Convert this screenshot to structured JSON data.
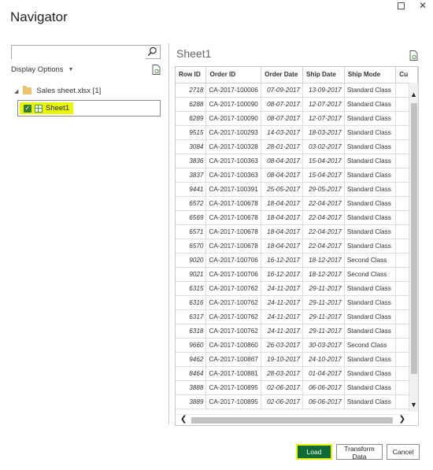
{
  "window": {
    "title": "Navigator",
    "maximize_icon": "maximize-icon",
    "close_glyph": "✕"
  },
  "left": {
    "search": {
      "value": "",
      "placeholder": ""
    },
    "display_options_label": "Display Options",
    "file_label": "Sales sheet.xlsx [1]",
    "sheet_label": "Sheet1",
    "sheet_checked": true,
    "highlight_color": "#e9f600"
  },
  "preview": {
    "title": "Sheet1",
    "columns": [
      "Row ID",
      "Order ID",
      "Order Date",
      "Ship Date",
      "Ship Mode",
      "Cu"
    ],
    "rows": [
      [
        "2718",
        "CA-2017-100006",
        "07-09-2017",
        "13-09-2017",
        "Standard Class"
      ],
      [
        "6288",
        "CA-2017-100090",
        "08-07-2017",
        "12-07-2017",
        "Standard Class"
      ],
      [
        "6289",
        "CA-2017-100090",
        "08-07-2017",
        "12-07-2017",
        "Standard Class"
      ],
      [
        "9515",
        "CA-2017-100293",
        "14-03-2017",
        "18-03-2017",
        "Standard Class"
      ],
      [
        "3084",
        "CA-2017-100328",
        "28-01-2017",
        "03-02-2017",
        "Standard Class"
      ],
      [
        "3836",
        "CA-2017-100363",
        "08-04-2017",
        "15-04-2017",
        "Standard Class"
      ],
      [
        "3837",
        "CA-2017-100363",
        "08-04-2017",
        "15-04-2017",
        "Standard Class"
      ],
      [
        "9441",
        "CA-2017-100391",
        "25-05-2017",
        "29-05-2017",
        "Standard Class"
      ],
      [
        "6572",
        "CA-2017-100678",
        "18-04-2017",
        "22-04-2017",
        "Standard Class"
      ],
      [
        "6569",
        "CA-2017-100678",
        "18-04-2017",
        "22-04-2017",
        "Standard Class"
      ],
      [
        "6571",
        "CA-2017-100678",
        "18-04-2017",
        "22-04-2017",
        "Standard Class"
      ],
      [
        "6570",
        "CA-2017-100678",
        "18-04-2017",
        "22-04-2017",
        "Standard Class"
      ],
      [
        "9020",
        "CA-2017-100706",
        "16-12-2017",
        "18-12-2017",
        "Second Class"
      ],
      [
        "9021",
        "CA-2017-100706",
        "16-12-2017",
        "18-12-2017",
        "Second Class"
      ],
      [
        "6315",
        "CA-2017-100762",
        "24-11-2017",
        "29-11-2017",
        "Standard Class"
      ],
      [
        "6316",
        "CA-2017-100762",
        "24-11-2017",
        "29-11-2017",
        "Standard Class"
      ],
      [
        "6317",
        "CA-2017-100762",
        "24-11-2017",
        "29-11-2017",
        "Standard Class"
      ],
      [
        "6318",
        "CA-2017-100762",
        "24-11-2017",
        "29-11-2017",
        "Standard Class"
      ],
      [
        "9660",
        "CA-2017-100860",
        "26-03-2017",
        "30-03-2017",
        "Second Class"
      ],
      [
        "9462",
        "CA-2017-100867",
        "19-10-2017",
        "24-10-2017",
        "Standard Class"
      ],
      [
        "8464",
        "CA-2017-100881",
        "28-03-2017",
        "01-04-2017",
        "Standard Class"
      ],
      [
        "3888",
        "CA-2017-100895",
        "02-06-2017",
        "06-06-2017",
        "Standard Class"
      ],
      [
        "3889",
        "CA-2017-100895",
        "02-06-2017",
        "06-06-2017",
        "Standard Class"
      ]
    ]
  },
  "buttons": {
    "load": "Load",
    "transform": "Transform Data",
    "cancel": "Cancel"
  },
  "colors": {
    "load_bg": "#0e6b36",
    "highlight": "#e9f600"
  }
}
